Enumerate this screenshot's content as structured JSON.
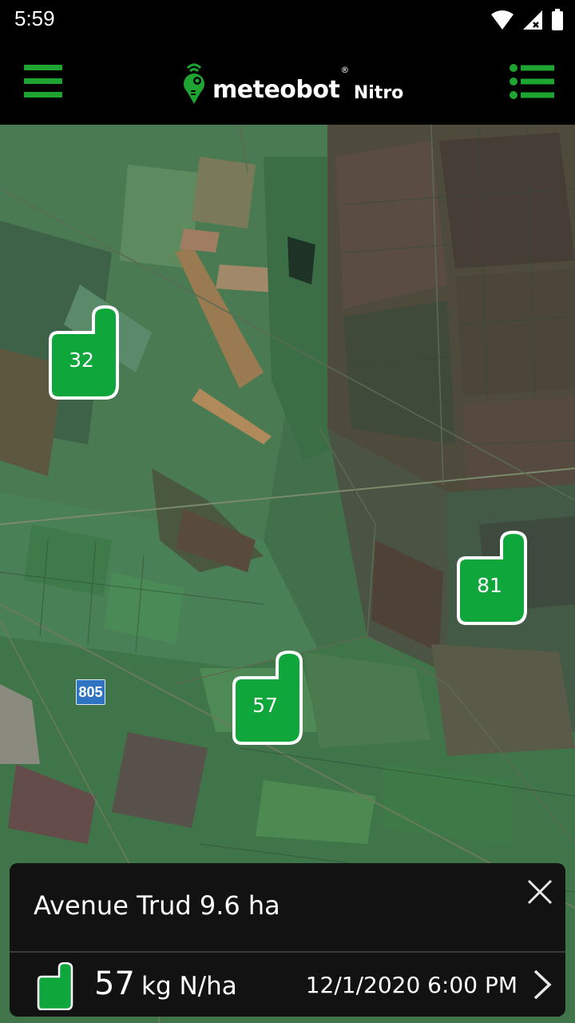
{
  "status_bar": {
    "time": "5:59",
    "icons": [
      "wifi-icon",
      "signal-icon",
      "battery-icon"
    ]
  },
  "app_bar": {
    "brand": "meteobot",
    "brand_mark": "®",
    "product": "Nitro",
    "left_icon": "hamburger-menu-icon",
    "right_icon": "list-view-icon",
    "accent_color": "#1ea531"
  },
  "map": {
    "road_label": "805",
    "markers": [
      {
        "id": "m32",
        "label": "32"
      },
      {
        "id": "m81",
        "label": "81"
      },
      {
        "id": "m57",
        "label": "57"
      }
    ]
  },
  "field_card": {
    "title": "Avenue Trud 9.6 ha",
    "value": "57",
    "unit": "kg N/ha",
    "datetime": "12/1/2020 6:00 PM",
    "close_icon": "close-icon",
    "next_icon": "chevron-right-icon",
    "thumb_color": "#0fa63c"
  }
}
